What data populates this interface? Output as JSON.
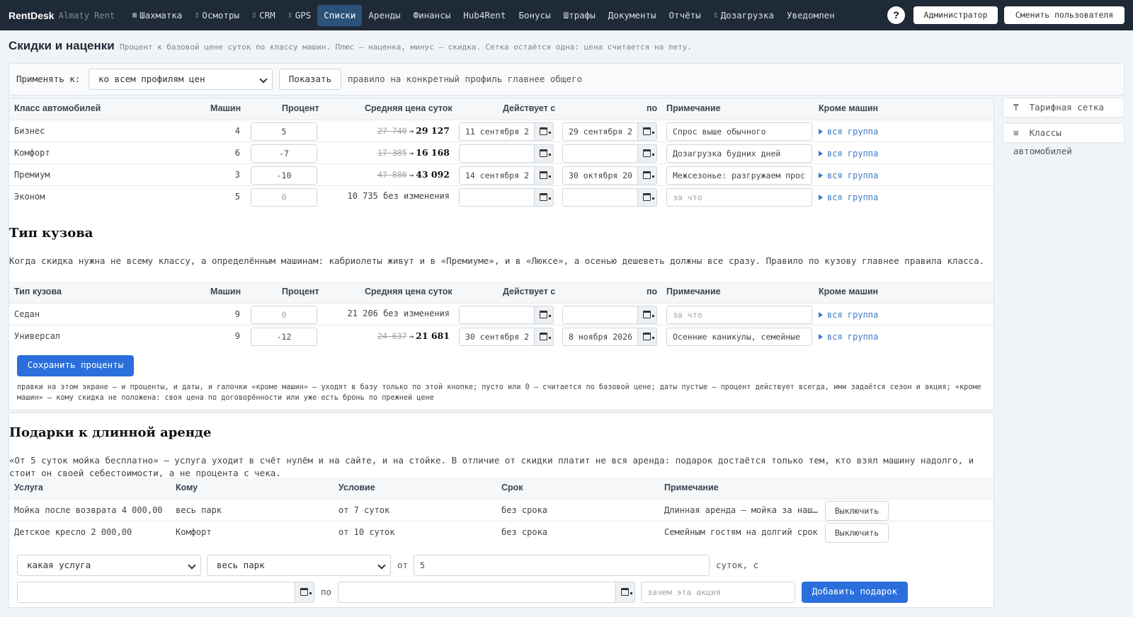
{
  "app": {
    "brand": "RentDesk",
    "city": "Almaty Rent"
  },
  "nav": [
    {
      "label": "Шахматка",
      "icon": "grid-icon",
      "glyph": "▦"
    },
    {
      "label": "Осмотры",
      "icon": "clipboard-icon",
      "glyph": "▯"
    },
    {
      "label": "CRM",
      "icon": "contact-icon",
      "glyph": "▯"
    },
    {
      "label": "GPS",
      "icon": "location-icon",
      "glyph": "▯"
    },
    {
      "label": "Списки",
      "icon": "",
      "glyph": ""
    },
    {
      "label": "Аренды",
      "icon": "",
      "glyph": ""
    },
    {
      "label": "Финансы",
      "icon": "",
      "glyph": ""
    },
    {
      "label": "Hub4Rent",
      "icon": "",
      "glyph": ""
    },
    {
      "label": "Бонусы",
      "icon": "",
      "glyph": ""
    },
    {
      "label": "Штрафы",
      "icon": "",
      "glyph": ""
    },
    {
      "label": "Документы",
      "icon": "",
      "glyph": ""
    },
    {
      "label": "Отчёты",
      "icon": "",
      "glyph": ""
    },
    {
      "label": "Дозагрузка",
      "icon": "upload-icon",
      "glyph": "▯"
    },
    {
      "label": "Уведомлен",
      "icon": "",
      "glyph": ""
    }
  ],
  "top_actions": {
    "help": "?",
    "admin": "Администратор",
    "switch_user": "Сменить пользователя"
  },
  "page": {
    "title": "Скидки и наценки",
    "description": "Процент к базовой цене суток по классу машин. Плюс — наценка, минус — скидка. Сетка остаётся одна: цена считается на лету."
  },
  "apply": {
    "label": "Применять к:",
    "selected": "ко всем профилям цен",
    "show_button": "Показать",
    "hint": "правило на конкретный профиль главнее общего"
  },
  "side": {
    "tariff_grid": "Тарифная сетка",
    "car_classes": "Классы автомобилей",
    "tariff_glyph": "₸",
    "classes_glyph": "≡"
  },
  "class_table": {
    "headers": [
      "Класс автомобилей",
      "Машин",
      "Процент",
      "Средняя цена суток",
      "Действует с",
      "по",
      "Примечание",
      "Кроме машин"
    ],
    "rows": [
      {
        "name": "Бизнес",
        "cars": "4",
        "percent": "5",
        "old_price": "27 740",
        "new_price": "29 127",
        "unchanged": "",
        "from": "11 сентября 2",
        "to": "29 сентября 2",
        "note": "Спрос выше обычного",
        "note_placeholder": false,
        "except": "вся группа"
      },
      {
        "name": "Комфорт",
        "cars": "6",
        "percent": "-7",
        "old_price": "17 385",
        "new_price": "16 168",
        "unchanged": "",
        "from": "",
        "to": "",
        "note": "Дозагрузка будних дней",
        "note_placeholder": false,
        "except": "вся группа"
      },
      {
        "name": "Премиум",
        "cars": "3",
        "percent": "-10",
        "old_price": "47 880",
        "new_price": "43 092",
        "unchanged": "",
        "from": "14 сентября 2",
        "to": "30 октября 20",
        "note": "Межсезонье: разгружаем прос",
        "note_placeholder": false,
        "except": "вся группа"
      },
      {
        "name": "Эконом",
        "cars": "5",
        "percent": "0",
        "old_price": "",
        "new_price": "",
        "unchanged": "10 735 без изменения",
        "from": "",
        "to": "",
        "note": "за что",
        "note_placeholder": true,
        "except": "вся группа"
      }
    ]
  },
  "body_section": {
    "title": "Тип кузова",
    "description": "Когда скидка нужна не всему классу, а определённым машинам: кабриолеты живут и в «Премиуме», и в «Люксе», а осенью дешеветь должны все сразу. Правило по кузову главнее правила класса.",
    "headers": [
      "Тип кузова",
      "Машин",
      "Процент",
      "Средняя цена суток",
      "Действует с",
      "по",
      "Примечание",
      "Кроме машин"
    ],
    "rows": [
      {
        "name": "Седан",
        "cars": "9",
        "percent": "0",
        "old_price": "",
        "new_price": "",
        "unchanged": "21 206 без изменения",
        "from": "",
        "to": "",
        "note": "за что",
        "note_placeholder": true,
        "except": "вся группа"
      },
      {
        "name": "Универсал",
        "cars": "9",
        "percent": "-12",
        "old_price": "24 637",
        "new_price": "21 681",
        "unchanged": "",
        "from": "30 сентября 2",
        "to": "8 ноября 2026",
        "note": "Осенние каникулы, семейные",
        "note_placeholder": false,
        "except": "вся группа"
      }
    ],
    "save_button": "Сохранить проценты",
    "fine_print": "правки на этом экране — и проценты, и даты, и галочки «кроме машин» — уходят в базу только по этой кнопке; пусто или 0 — считается по базовой цене; даты пустые — процент действует всегда, ими задаётся сезон и акция; «кроме машин» — кому скидка не положена: своя цена по договорённости или уже есть бронь по прежней цене"
  },
  "gifts": {
    "title": "Подарки к длинной аренде",
    "description": "«От 5 суток мойка бесплатно» — услуга уходит в счёт нулём и на сайте, и на стойке. В отличие от скидки платит не вся аренда: подарок достаётся только тем, кто взял машину надолго, и стоит он своей себестоимости, а не процента с чека.",
    "headers": [
      "Услуга",
      "Кому",
      "Условие",
      "Срок",
      "Примечание"
    ],
    "rows": [
      {
        "service": "Мойка после возврата 4 000,00",
        "whom": "весь парк",
        "condition": "от 7 суток",
        "term": "без срока",
        "note": "Длинная аренда — мойка за наш…",
        "action": "Выключить"
      },
      {
        "service": "Детское кресло 2 000,00",
        "whom": "Комфорт",
        "condition": "от 10 суток",
        "term": "без срока",
        "note": "Семейным гостям на долгий срок",
        "action": "Выключить"
      }
    ],
    "form": {
      "service_select": "какая услуга",
      "whom_select": "весь парк",
      "from_label": "от",
      "days_value": "5",
      "days_label": "суток, с",
      "to_label": "по",
      "reason_placeholder": "зачем эта акция",
      "add_button": "Добавить подарок"
    }
  },
  "colors": {
    "topbar": "#1f2a37",
    "active_nav": "#2b5278",
    "primary": "#2a6fdb",
    "link": "#3d7ac7"
  }
}
